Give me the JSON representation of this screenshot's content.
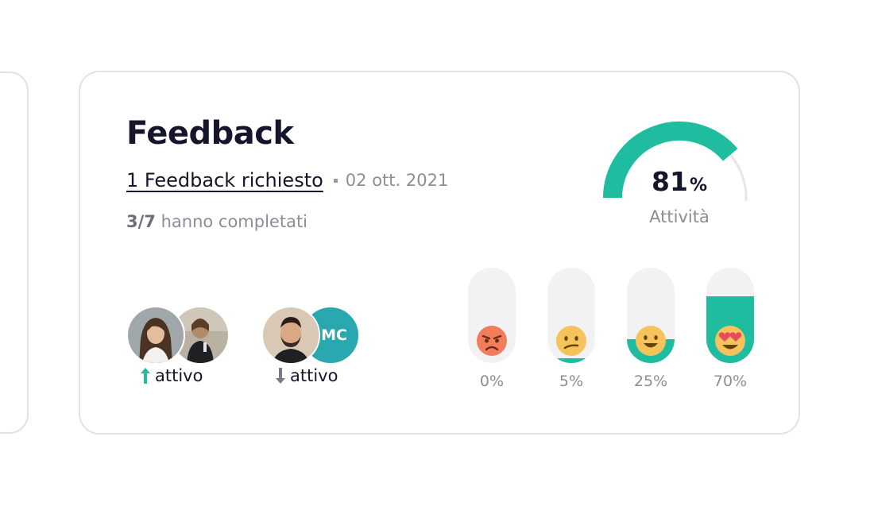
{
  "card": {
    "title": "Feedback",
    "request_link": "1 Feedback richiesto",
    "date": "02 ott. 2021",
    "completed_count": "3/7",
    "completed_text": "hanno completati"
  },
  "gauge": {
    "value": "81",
    "unit": "%",
    "fraction": 0.81,
    "label": "Attività",
    "color": "#20bc9f",
    "track_color": "#e6e6ea"
  },
  "groups": [
    {
      "trend_icon": "arrow-up-icon",
      "trend_color": "#20bc9f",
      "label": "attivo"
    },
    {
      "trend_icon": "arrow-down-icon",
      "trend_color": "#7a7a86",
      "label": "attivo",
      "initials": "MC"
    }
  ],
  "moods": [
    {
      "emoji": "angry-face-icon",
      "label": "0%",
      "fill": 0.0
    },
    {
      "emoji": "confused-face-icon",
      "label": "5%",
      "fill": 0.05
    },
    {
      "emoji": "smiling-face-icon",
      "label": "25%",
      "fill": 0.25
    },
    {
      "emoji": "heart-eyes-face-icon",
      "label": "70%",
      "fill": 0.7
    }
  ],
  "colors": {
    "accent": "#20bc9f",
    "text": "#15162b",
    "muted": "#8d8d98",
    "border": "#e2e2e6"
  }
}
